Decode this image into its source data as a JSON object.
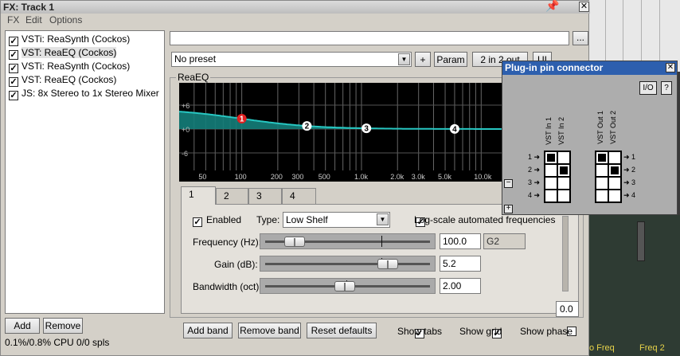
{
  "window": {
    "title": "FX: Track 1",
    "pin_glyph": "📌",
    "close_glyph": "✕"
  },
  "menu": [
    "FX",
    "Edit",
    "Options"
  ],
  "fx_chain": [
    {
      "label": "VSTi: ReaSynth (Cockos)",
      "checked": true,
      "selected": false
    },
    {
      "label": "VST: ReaEQ (Cockos)",
      "checked": true,
      "selected": true
    },
    {
      "label": "VSTi: ReaSynth (Cockos)",
      "checked": true,
      "selected": false
    },
    {
      "label": "VST: ReaEQ (Cockos)",
      "checked": true,
      "selected": false
    },
    {
      "label": "JS: 8x Stereo to 1x Stereo Mixer",
      "checked": true,
      "selected": false
    }
  ],
  "list_buttons": {
    "add": "Add",
    "remove": "Remove"
  },
  "cpu": "0.1%/0.8% CPU 0/0 spls",
  "preset": {
    "name_field": "",
    "ellipsis": "...",
    "combo": "No preset",
    "plus": "+",
    "param": "Param",
    "io": "2 in 2 out",
    "ui": "UI"
  },
  "plugin": {
    "name": "ReaEQ",
    "db_labels": [
      "+6",
      "+0",
      "-6"
    ],
    "freq_labels": [
      "50",
      "100",
      "200",
      "300",
      "500",
      "1.0k",
      "2.0k",
      "3.0k",
      "5.0k",
      "10.0k"
    ],
    "bands": [
      {
        "label": "1",
        "freq_hz": 100,
        "color": "#e02020"
      },
      {
        "label": "2",
        "freq_hz": 350,
        "color": "#ffffff"
      },
      {
        "label": "3",
        "freq_hz": 1100,
        "color": "#ffffff"
      },
      {
        "label": "4",
        "freq_hz": 6000,
        "color": "#ffffff"
      }
    ],
    "curve_color": "#27c7c2",
    "fill_color": "#147e7a"
  },
  "tabs": [
    "1",
    "2",
    "3",
    "4"
  ],
  "band_panel": {
    "enabled_label": "Enabled",
    "enabled": true,
    "type_label": "Type:",
    "type_value": "Low Shelf",
    "logscale_label": "Log-scale automated frequencies",
    "logscale": true,
    "frequency_label": "Frequency (Hz):",
    "frequency_value": "100.0",
    "frequency_note": "G2",
    "frequency_level": 0.13,
    "gain_label": "Gain (dB):",
    "gain_value": "5.2",
    "gain_level": 0.78,
    "bandwidth_label": "Bandwidth (oct):",
    "bandwidth_value": "2.00",
    "bandwidth_level": 0.48
  },
  "bottom": {
    "add_band": "Add band",
    "remove_band": "Remove band",
    "reset_defaults": "Reset defaults",
    "show_tabs": "Show tabs",
    "show_tabs_on": true,
    "show_grid": "Show grid",
    "show_grid_on": true,
    "show_phase": "Show phase",
    "show_phase_on": false
  },
  "right_value": "0.0",
  "pin_connector": {
    "title": "Plug-in pin connector",
    "io_button": "I/O",
    "help_button": "?",
    "inputs": [
      "VST In 1",
      "VST In 2"
    ],
    "outputs": [
      "VST Out 1",
      "VST Out 2"
    ],
    "rows": [
      "1",
      "2",
      "3",
      "4"
    ],
    "input_map": [
      [
        true,
        false
      ],
      [
        false,
        true
      ],
      [
        false,
        false
      ],
      [
        false,
        false
      ]
    ],
    "output_map": [
      [
        true,
        false
      ],
      [
        false,
        true
      ],
      [
        false,
        false
      ],
      [
        false,
        false
      ]
    ],
    "minus": "−",
    "plus": "+"
  },
  "background_labels": [
    "o Freq",
    "Freq 2"
  ]
}
